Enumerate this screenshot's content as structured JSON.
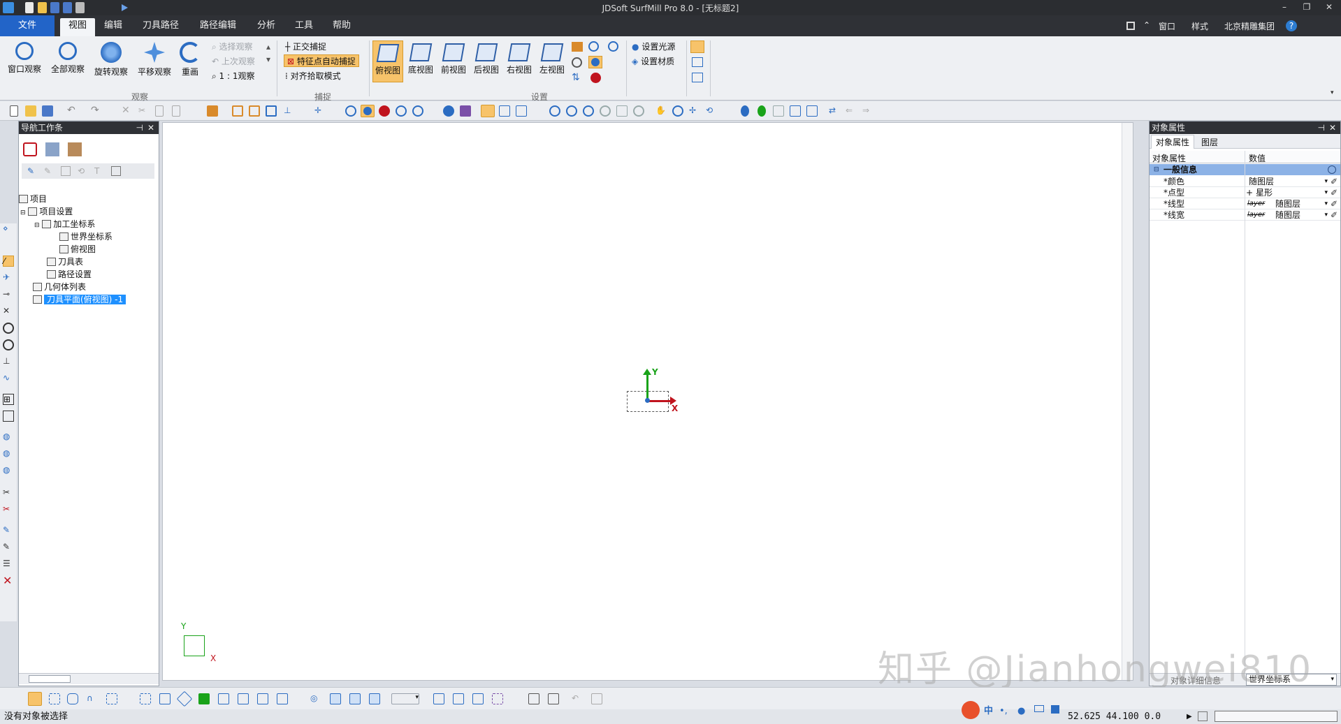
{
  "window": {
    "title": "JDSoft SurfMill Pro 8.0 - [无标题2]",
    "controls": [
      "–",
      "❐",
      "✕"
    ]
  },
  "menu": {
    "file": "文件",
    "tabs": [
      "视图",
      "编辑",
      "刀具路径",
      "路径编辑",
      "分析",
      "工具",
      "帮助"
    ],
    "active_tab": "视图",
    "right": {
      "window": "窗口",
      "style": "样式",
      "company": "北京精雕集团",
      "help": "?"
    }
  },
  "ribbon": {
    "observe_buttons": [
      "窗口观察",
      "全部观察",
      "旋转观察",
      "平移观察",
      "重画"
    ],
    "observe_small": [
      "选择观察",
      "上次观察",
      "1 : 1观察"
    ],
    "group_observe": "观察",
    "snap_items": [
      "正交捕捉",
      "特征点自动捕捉",
      "对齐拾取模式"
    ],
    "group_snap": "捕捉",
    "views": [
      "俯视图",
      "底视图",
      "前视图",
      "后视图",
      "右视图",
      "左视图"
    ],
    "active_view": "俯视图",
    "light_items": [
      "设置光源",
      "设置材质"
    ],
    "group_settings": "设置"
  },
  "nav_panel": {
    "title": "导航工作条",
    "tree": [
      {
        "label": "项目",
        "level": 0
      },
      {
        "label": "项目设置",
        "level": 1
      },
      {
        "label": "加工坐标系",
        "level": 2
      },
      {
        "label": "世界坐标系",
        "level": 3
      },
      {
        "label": "俯视图",
        "level": 3
      },
      {
        "label": "刀具表",
        "level": 2
      },
      {
        "label": "路径设置",
        "level": 2
      },
      {
        "label": "几何体列表",
        "level": 1
      },
      {
        "label": "刀具平面(俯视图) -1",
        "level": 1,
        "selected": true
      }
    ]
  },
  "canvas": {
    "axis_y": "Y",
    "axis_x": "X",
    "corner_y": "Y",
    "corner_x": "X"
  },
  "props_panel": {
    "title": "对象属性",
    "tabs": [
      "对象属性",
      "图层"
    ],
    "col_name": "对象属性",
    "col_value": "数值",
    "group": "一般信息",
    "rows": [
      {
        "name": "*颜色",
        "value": "随图层"
      },
      {
        "name": "*点型",
        "value": "星形"
      },
      {
        "name": "*线型",
        "value": "随图层"
      },
      {
        "name": "*线宽",
        "value": "随图层"
      }
    ],
    "layer_glyph": "layer",
    "detail_label": "对象详细信息",
    "coord_select": "世界坐标系"
  },
  "status": {
    "message": "没有对象被选择",
    "coords": "52.625 44.100 0.0",
    "ime": [
      "中",
      "•,"
    ]
  },
  "watermark": "知乎 @Jianhongwei810",
  "colors": {
    "accent": "#2264c8",
    "selection": "#1e90ff",
    "axis_x": "#c0141e",
    "axis_y": "#1aa31a",
    "active_view": "#f7c36a"
  }
}
